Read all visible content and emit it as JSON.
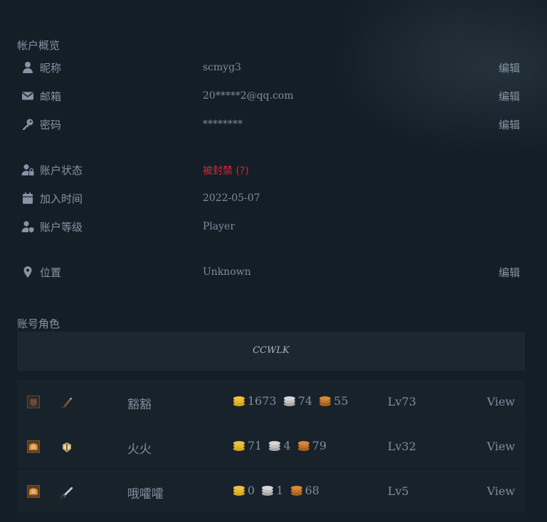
{
  "overview": {
    "title": "帐户概览",
    "rows": [
      {
        "icon": "user-icon",
        "label": "昵称",
        "value": "scmyg3",
        "edit": "编辑"
      },
      {
        "icon": "envelope-icon",
        "label": "邮箱",
        "value": "20*****2@qq.com",
        "edit": "编辑"
      },
      {
        "icon": "key-icon",
        "label": "密码",
        "value": "********",
        "edit": "编辑"
      },
      {
        "icon": "user-lock-icon",
        "label": "账户状态",
        "value": "被封禁 (?)"
      },
      {
        "icon": "calendar-icon",
        "label": "加入时间",
        "value": "2022-05-07"
      },
      {
        "icon": "user-shield-icon",
        "label": "账户等级",
        "value": "Player"
      },
      {
        "icon": "map-marker-icon",
        "label": "位置",
        "value": "Unknown",
        "edit": "编辑"
      }
    ],
    "banned_color": "#e0252b"
  },
  "characters": {
    "title": "账号角色",
    "realm": "CCWLK",
    "rows": [
      {
        "race_icon": "undead-portrait-icon",
        "class_icon": "rogue-weapon-icon",
        "name": "豁豁",
        "gold": "1673",
        "silver": "74",
        "copper": "55",
        "level": "Lv73",
        "action": "View"
      },
      {
        "race_icon": "human-portrait-icon",
        "class_icon": "paladin-icon",
        "name": "火火",
        "gold": "71",
        "silver": "4",
        "copper": "79",
        "level": "Lv32",
        "action": "View"
      },
      {
        "race_icon": "human-portrait-icon",
        "class_icon": "warrior-sword-icon",
        "name": "哦嚯嚯",
        "gold": "0",
        "silver": "1",
        "copper": "68",
        "level": "Lv5",
        "action": "View"
      }
    ],
    "coin_colors": {
      "gold": "#d9a520",
      "silver": "#b8b8b8",
      "copper": "#c0732a"
    }
  }
}
